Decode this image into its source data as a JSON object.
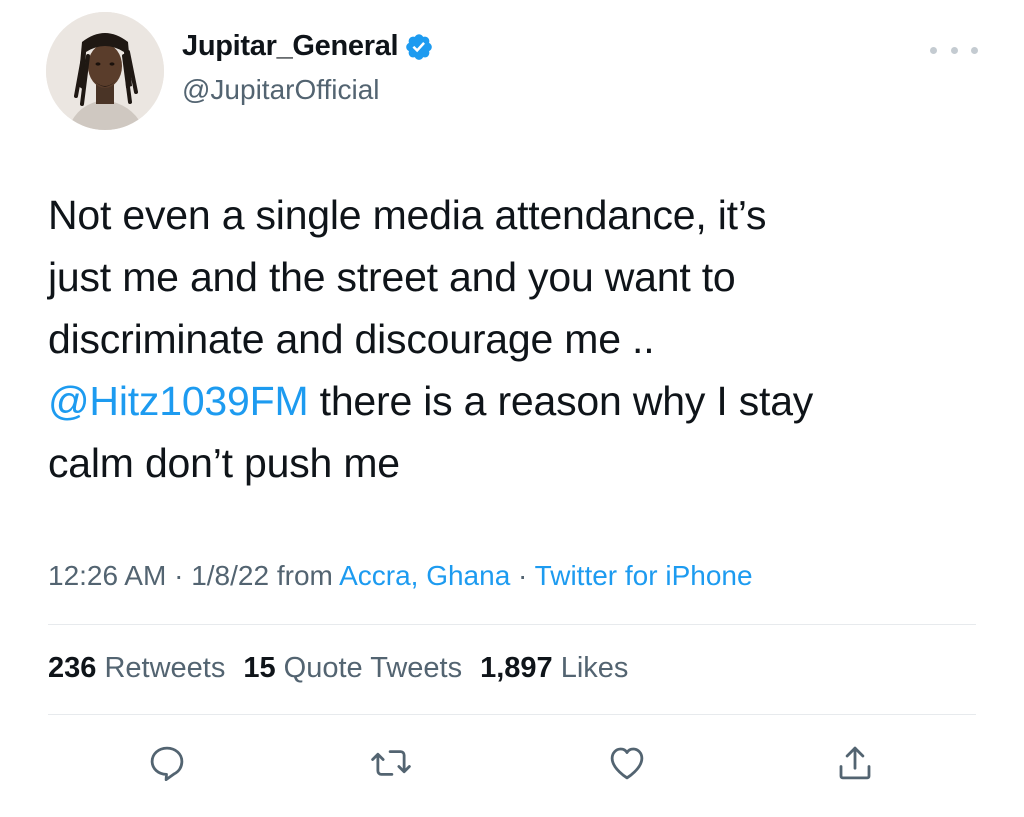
{
  "author": {
    "display_name": "Jupitar_General",
    "handle": "@JupitarOfficial",
    "verified": true
  },
  "tweet": {
    "text_line1": "Not even a single media attendance, it’s",
    "text_line2": "just me and the street and you want to",
    "text_line3": "discriminate and discourage me ..",
    "mention": "@Hitz1039FM",
    "text_line4_rest": " there is a reason why I stay",
    "text_line5": "calm don’t push me"
  },
  "meta": {
    "time": "12:26 AM",
    "sep1": " · ",
    "date": "1/8/22",
    "from": " from ",
    "location": "Accra, Ghana",
    "sep2": " · ",
    "source": "Twitter for iPhone"
  },
  "stats": {
    "retweets_count": "236",
    "retweets_label": "Retweets",
    "quotes_count": "15",
    "quotes_label": "Quote Tweets",
    "likes_count": "1,897",
    "likes_label": "Likes"
  },
  "icons": {
    "reply": "reply-icon",
    "retweet": "retweet-icon",
    "like": "like-icon",
    "share": "share-icon",
    "more": "more-icon",
    "verified": "verified-badge-icon"
  },
  "colors": {
    "accent": "#1d9bf0",
    "muted": "#536471",
    "text": "#0f1419"
  }
}
